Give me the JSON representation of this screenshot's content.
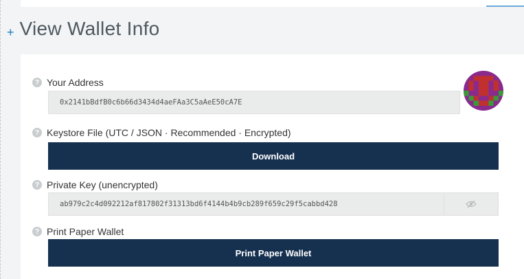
{
  "section": {
    "plus": "+",
    "title": "View Wallet Info"
  },
  "address": {
    "label": "Your Address",
    "value": "0x2141bBdfB0c6b66d3434d4aeFAa3C5aAeE50cA7E"
  },
  "keystore": {
    "label": "Keystore File (UTC / JSON · Recommended · Encrypted)",
    "button": "Download"
  },
  "private_key": {
    "label": "Private Key (unencrypted)",
    "value": "ab979c2c4d092212af817802f31313bd6f4144b4b9cb289f659c29f5cabbd428",
    "toggle_icon": "eye-slash-icon"
  },
  "paper": {
    "label": "Print Paper Wallet",
    "button": "Print Paper Wallet"
  },
  "help_glyph": "?",
  "colors": {
    "button_bg": "#163150",
    "accent": "#1c7fbf",
    "avatar_purple": "#8a2a8c",
    "avatar_red": "#c0302e",
    "avatar_green": "#3a9a3a"
  }
}
